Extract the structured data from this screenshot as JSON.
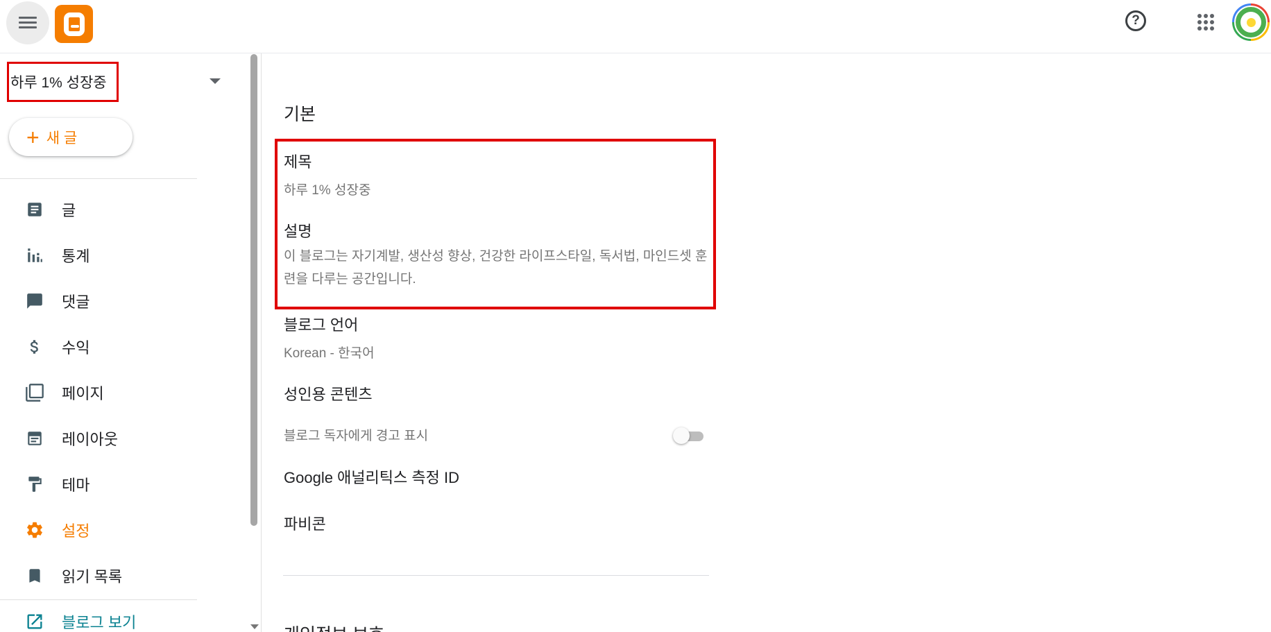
{
  "header": {
    "menu_icon": "hamburger-menu-icon",
    "logo_icon": "blogger-logo-icon",
    "help_icon": "help-circle-icon",
    "apps_icon": "apps-grid-icon",
    "help_glyph": "?"
  },
  "sidebar": {
    "blog_name": "하루 1% 성장중",
    "new_post": {
      "plus": "+",
      "label": "새 글"
    },
    "items": [
      {
        "label": "글",
        "icon": "posts-icon"
      },
      {
        "label": "통계",
        "icon": "stats-icon"
      },
      {
        "label": "댓글",
        "icon": "comments-icon"
      },
      {
        "label": "수익",
        "icon": "dollar-icon"
      },
      {
        "label": "페이지",
        "icon": "pages-icon"
      },
      {
        "label": "레이아웃",
        "icon": "layout-icon"
      },
      {
        "label": "테마",
        "icon": "theme-icon"
      },
      {
        "label": "설정",
        "icon": "gear-icon",
        "active": true
      },
      {
        "label": "읽기 목록",
        "icon": "bookmark-icon"
      },
      {
        "label": "블로그 보기",
        "icon": "open-external-icon"
      }
    ]
  },
  "settings": {
    "section_basic": "기본",
    "title_label": "제목",
    "title_value": "하루 1% 성장중",
    "description_label": "설명",
    "description_value": "이 블로그는 자기계발, 생산성 향상, 건강한 라이프스타일, 독서법, 마인드셋 훈련을 다루는 공간입니다.",
    "language_label": "블로그 언어",
    "language_value": "Korean - 한국어",
    "adult_label": "성인용 콘텐츠",
    "adult_toggle_label": "블로그 독자에게 경고 표시",
    "adult_toggle_on": false,
    "analytics_label": "Google 애널리틱스 측정 ID",
    "favicon_label": "파비콘",
    "section_privacy": "개인정보 보호"
  },
  "colors": {
    "accent": "#f57d00",
    "highlight_border": "#e00000",
    "link_teal": "#0b8291"
  }
}
